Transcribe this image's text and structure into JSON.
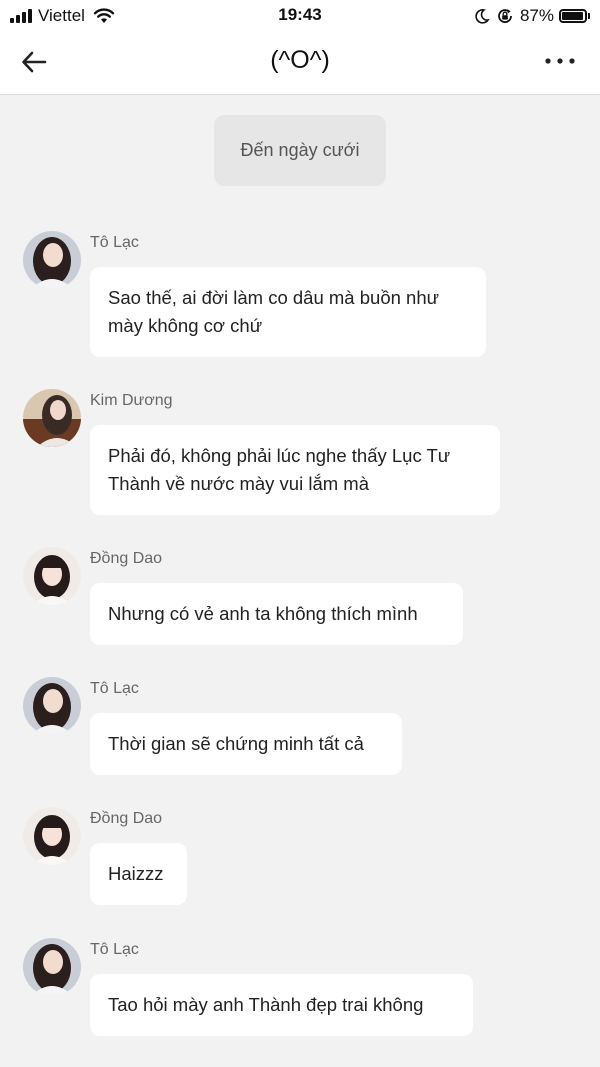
{
  "status_bar": {
    "carrier": "Viettel",
    "time": "19:43",
    "battery_percent": "87%",
    "battery_level": 0.87
  },
  "header": {
    "title": "(^O^)",
    "back_icon": "arrow-left-icon",
    "more_icon": "ellipsis-icon"
  },
  "event_chip": "Đến ngày cưới",
  "messages": [
    {
      "sender": "Tô Lạc",
      "text": "Sao thế, ai đời làm co dâu mà buồn như mày không cơ chứ"
    },
    {
      "sender": "Kim Dương",
      "text": "Phải đó, không phải lúc nghe thấy Lục Tư Thành về nước mày vui lắm mà"
    },
    {
      "sender": "Đồng Dao",
      "text": "Nhưng có vẻ anh ta không thích mình"
    },
    {
      "sender": "Tô Lạc",
      "text": "Thời gian sẽ chứng minh tất cả"
    },
    {
      "sender": "Đồng Dao",
      "text": "Haizzz"
    },
    {
      "sender": "Tô Lạc",
      "text": "Tao hỏi mày anh Thành đẹp trai không"
    }
  ],
  "colors": {
    "background": "#f2f2f2",
    "bubble": "#ffffff",
    "chip": "#e6e6e6",
    "sender_name": "#666666"
  }
}
